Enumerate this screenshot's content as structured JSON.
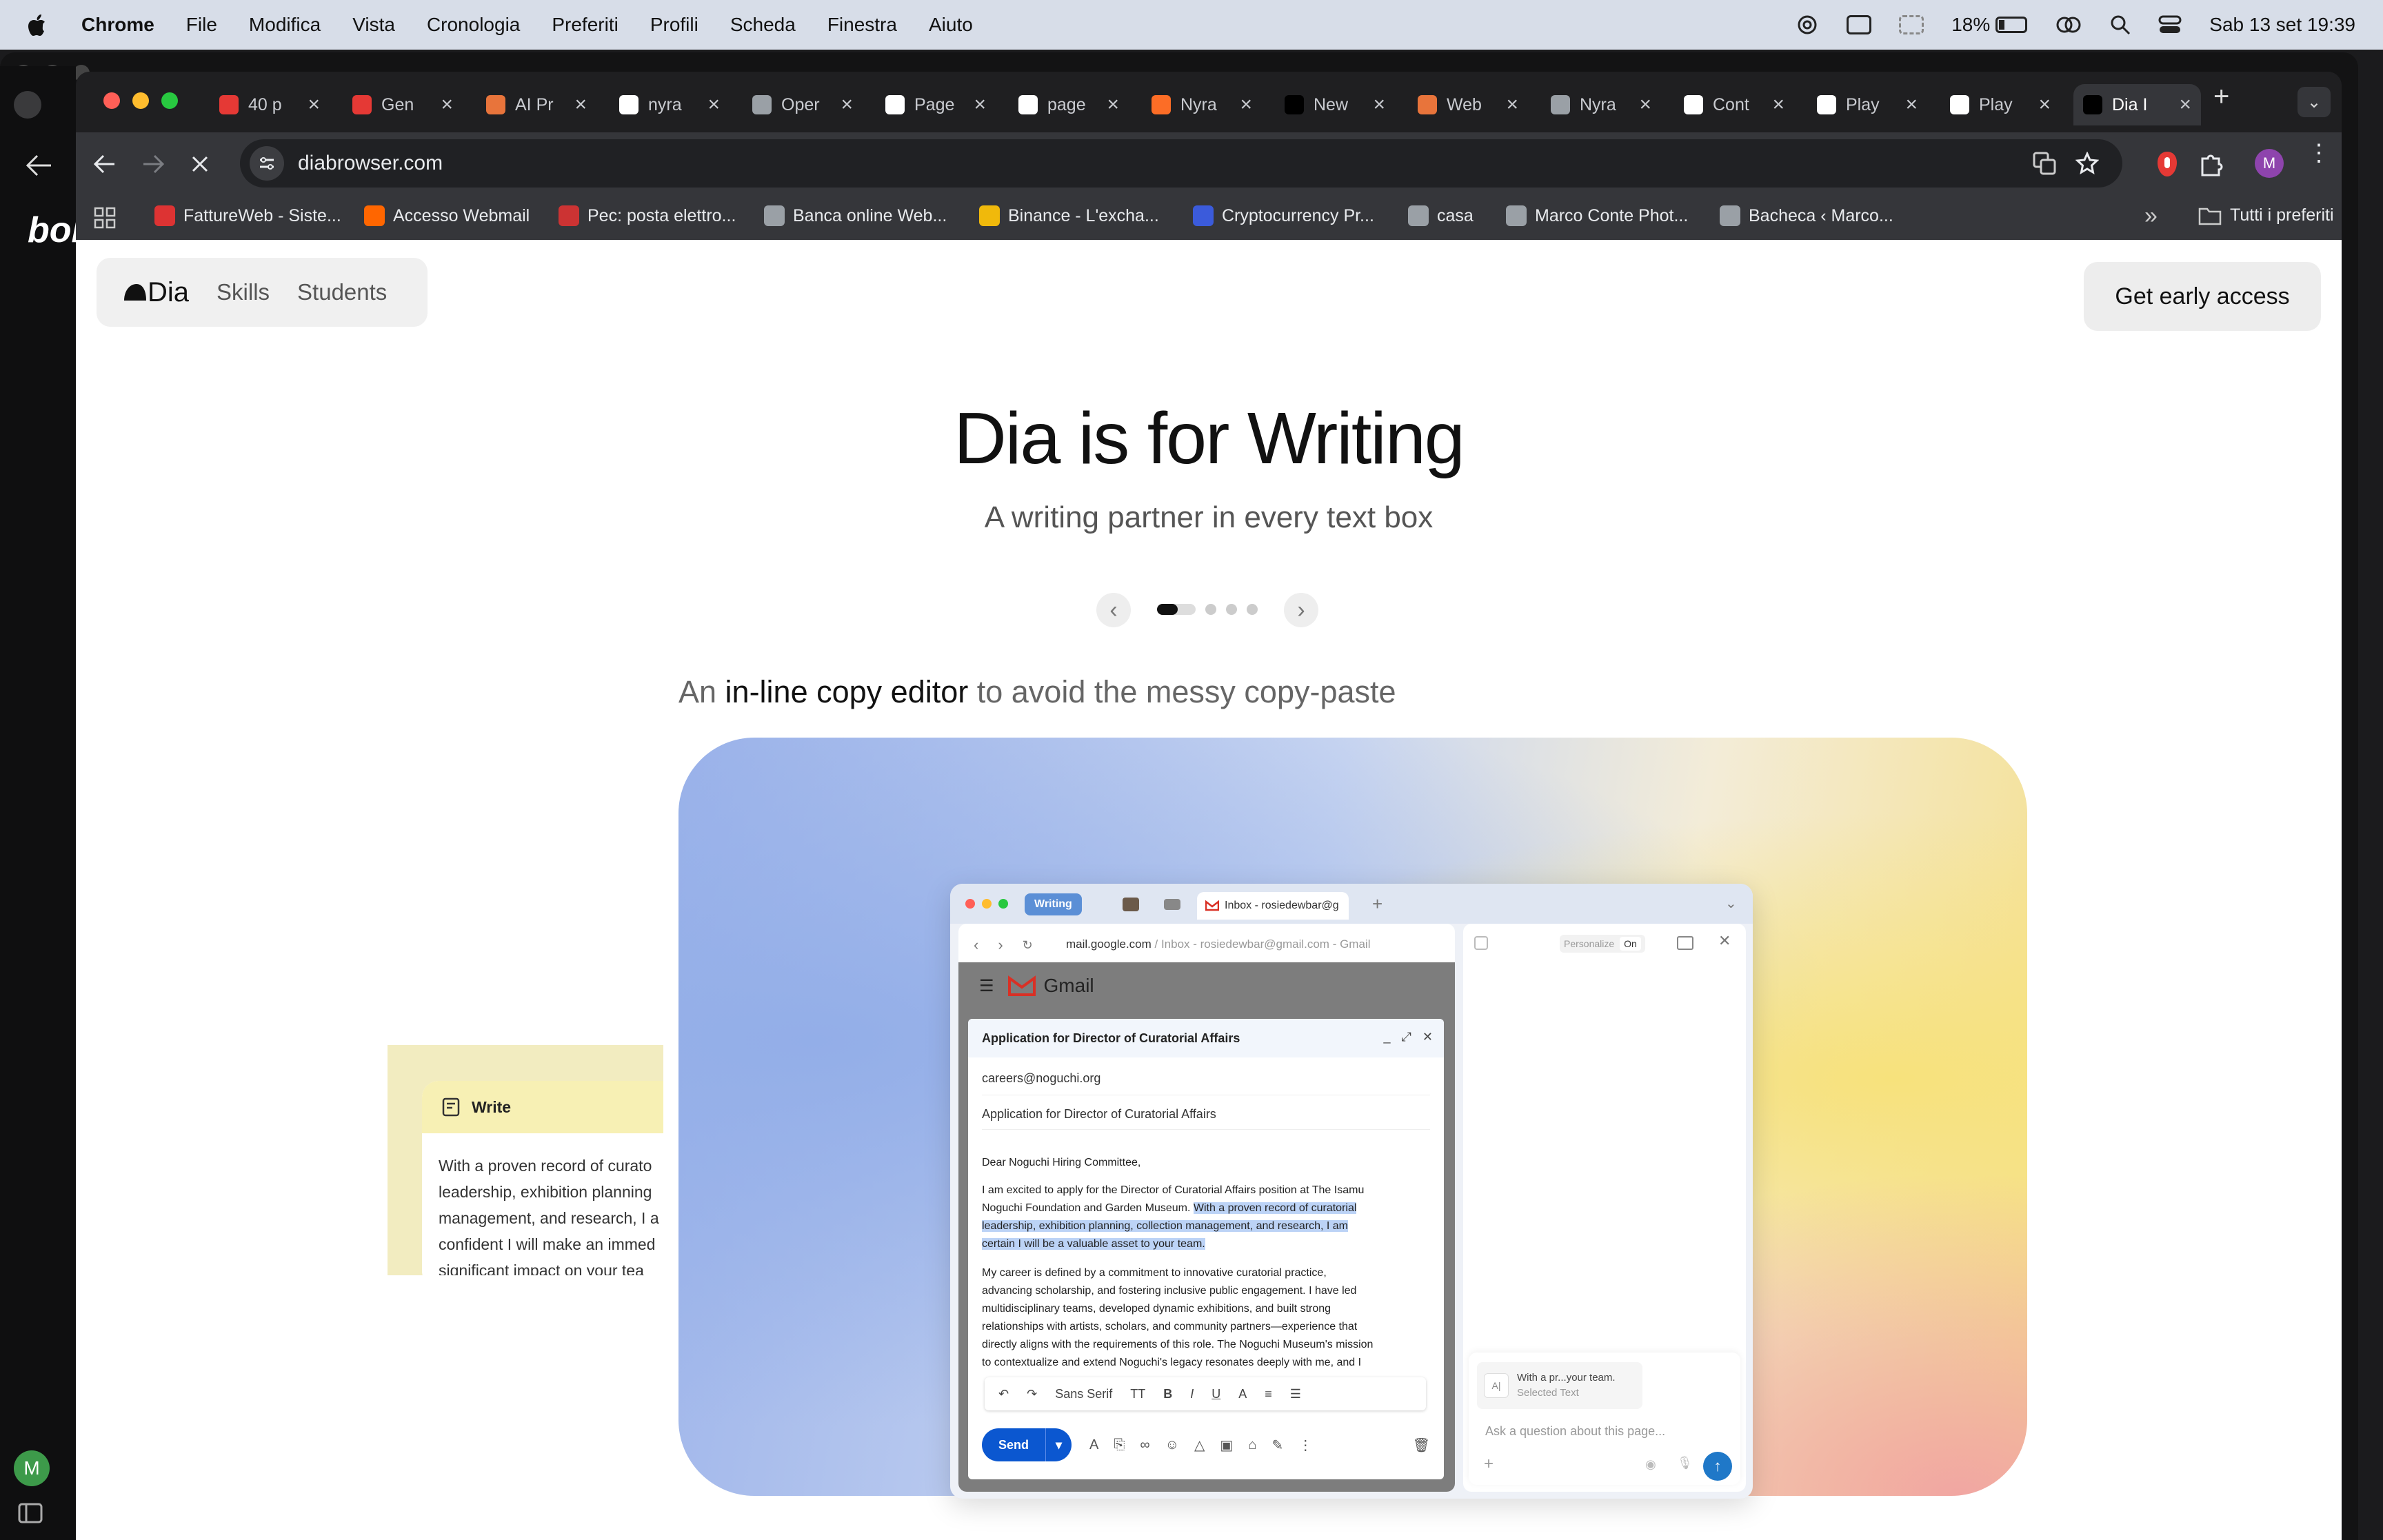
{
  "menubar": {
    "app": "Chrome",
    "items": [
      "File",
      "Modifica",
      "Vista",
      "Cronologia",
      "Preferiti",
      "Profili",
      "Scheda",
      "Finestra",
      "Aiuto"
    ],
    "battery": "18%",
    "datetime": "Sab 13 set  19:39"
  },
  "backwindow": {
    "logo": "bol",
    "avatar": "M"
  },
  "tabs": [
    {
      "title": "40 p",
      "icon_color": "#e53935"
    },
    {
      "title": "Gen",
      "icon_color": "#e53935"
    },
    {
      "title": "AI Pr",
      "icon_color": "#e8743b"
    },
    {
      "title": "nyra",
      "icon_color": "#ffffff"
    },
    {
      "title": "Oper",
      "icon_color": "#9aa0a6"
    },
    {
      "title": "Page",
      "icon_color": "#ffffff"
    },
    {
      "title": "page",
      "icon_color": "#ffffff"
    },
    {
      "title": "Nyra",
      "icon_color": "#fc6d26"
    },
    {
      "title": "New",
      "icon_color": "#000000"
    },
    {
      "title": "Web",
      "icon_color": "#e8743b"
    },
    {
      "title": "Nyra",
      "icon_color": "#9aa0a6"
    },
    {
      "title": "Cont",
      "icon_color": "#ffffff"
    },
    {
      "title": "Play",
      "icon_color": "#ffffff"
    },
    {
      "title": "Play",
      "icon_color": "#ffffff"
    },
    {
      "title": "Dia I",
      "icon_color": "#000000"
    }
  ],
  "toolbar": {
    "url": "diabrowser.com",
    "profile": "M"
  },
  "bookmarks": [
    {
      "label": "FattureWeb - Siste...",
      "color": "#d33"
    },
    {
      "label": "Accesso Webmail",
      "color": "#f60"
    },
    {
      "label": "Pec: posta elettro...",
      "color": "#c33"
    },
    {
      "label": "Banca online Web...",
      "color": "#9aa0a6"
    },
    {
      "label": "Binance - L'excha...",
      "color": "#f0b90b"
    },
    {
      "label": "Cryptocurrency Pr...",
      "color": "#3b5bdb"
    },
    {
      "label": "casa",
      "color": "#9aa0a6"
    },
    {
      "label": "Marco Conte Phot...",
      "color": "#9aa0a6"
    },
    {
      "label": "Bacheca ‹ Marco...",
      "color": "#9aa0a6"
    }
  ],
  "bookmarks_more": "»",
  "bookmarks_all": "Tutti i preferiti",
  "site": {
    "logo": "Dia",
    "nav": [
      "Skills",
      "Students"
    ],
    "cta": "Get early access",
    "title": "Dia is for Writing",
    "subtitle": "A writing partner in every text box",
    "carousel": {
      "active": 1,
      "count": 5
    },
    "feature_pre": "An ",
    "feature_bold": "in-line copy editor",
    "feature_post": " to avoid the messy copy-paste"
  },
  "writecard": {
    "title": "Write",
    "lines": [
      "With a proven record of curato",
      "leadership, exhibition planning",
      "management, and research, I a",
      "confident I will make an immed",
      "significant impact on your tea"
    ]
  },
  "mock": {
    "tab_writing": "Writing",
    "tab_inbox": "Inbox - rosiedewbar@g",
    "url": "mail.google.com",
    "url_rest": " / Inbox - rosiedewbar@gmail.com - Gmail",
    "gmail": "Gmail",
    "personalize": "Personalize",
    "personalize_state": "On",
    "compose_title": "Application for Director of Curatorial Affairs",
    "to": "careers@noguchi.org",
    "subject": "Application for Director of Curatorial Affairs",
    "greeting": "Dear Noguchi Hiring Committee,",
    "p1_a": "I am excited to apply for the Director of Curatorial Affairs position at The Isamu",
    "p1_b": "Noguchi Foundation and Garden Museum. ",
    "p1_sel1": "With a proven record of curatorial",
    "p1_sel2": "leadership, exhibition planning, collection management, and research, I am",
    "p1_sel3": "certain I will be a valuable asset to your team.",
    "p2": [
      "My career is defined by a commitment to innovative curatorial practice,",
      "advancing scholarship, and fostering inclusive public engagement. I have led",
      "multidisciplinary teams, developed dynamic exhibitions, and built strong",
      "relationships with artists, scholars, and community partners—experience that",
      "directly aligns with the requirements of this role. The Noguchi Museum's mission",
      "to contextualize and extend Noguchi's legacy resonates deeply with me, and I"
    ],
    "font": "Sans Serif",
    "send": "Send",
    "chip_title": "With a pr...your team.",
    "chip_sub": "Selected Text",
    "ask_placeholder": "Ask a question about this page..."
  }
}
